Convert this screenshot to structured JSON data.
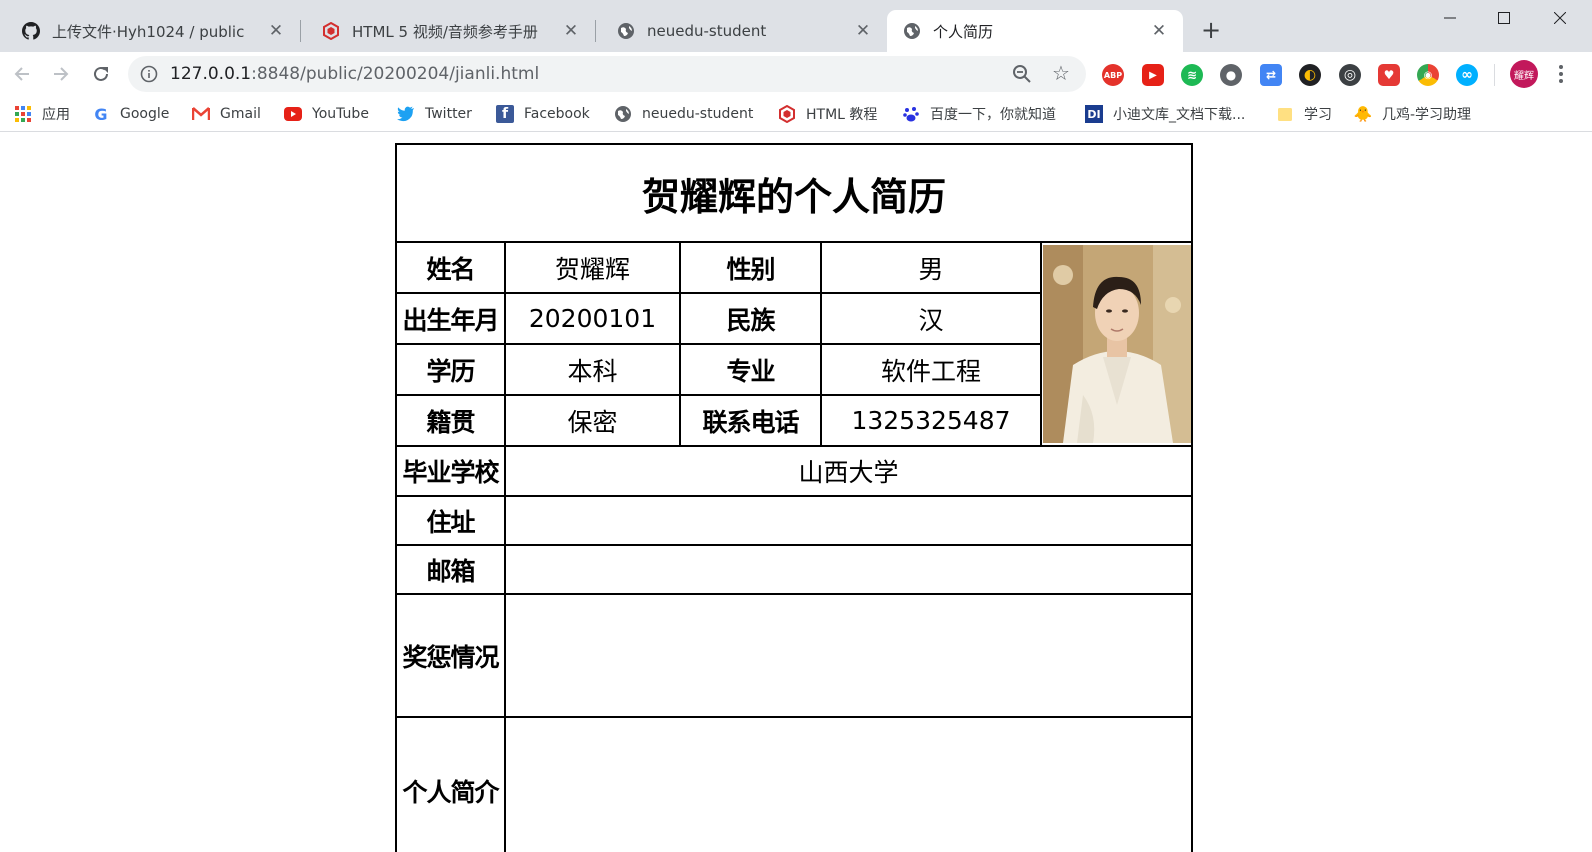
{
  "tabs": [
    {
      "title": "上传文件·Hyh1024 / public",
      "icon": "github-icon",
      "active": false
    },
    {
      "title": "HTML 5 视频/音频参考手册",
      "icon": "runoob-icon",
      "active": false
    },
    {
      "title": "neuedu-student",
      "icon": "globe-icon",
      "active": false
    },
    {
      "title": "个人简历",
      "icon": "globe-icon",
      "active": true
    }
  ],
  "toolbar": {
    "url_host": "127.0.0.1",
    "url_path": ":8848/public/20200204/jianli.html",
    "profile_label": "耀辉"
  },
  "extensions": [
    {
      "name": "adblock-plus-icon",
      "label": "ABP",
      "color": "#e4322b"
    },
    {
      "name": "youtube-ext-icon",
      "label": "▶",
      "color": "#e62117"
    },
    {
      "name": "spotify-ext-icon",
      "label": "≋",
      "color": "#1db954"
    },
    {
      "name": "people-ext-icon",
      "label": "●",
      "color": "#5f6368"
    },
    {
      "name": "translate-ext-icon",
      "label": "⇄",
      "color": "#4285f4"
    },
    {
      "name": "moon-ext-icon",
      "label": "◐",
      "color": "#202124"
    },
    {
      "name": "proxy-ext-icon",
      "label": "◎",
      "color": "#3c4043"
    },
    {
      "name": "red-ext-icon",
      "label": "♥",
      "color": "#e53935"
    },
    {
      "name": "chrome-ext-icon",
      "label": "◉",
      "color": "#fbbc04"
    },
    {
      "name": "infinity-ext-icon",
      "label": "∞",
      "color": "#00b0ff"
    }
  ],
  "bookmarks": [
    {
      "label": "应用",
      "icon": "apps-icon"
    },
    {
      "label": "Google",
      "icon": "google-icon"
    },
    {
      "label": "Gmail",
      "icon": "gmail-icon"
    },
    {
      "label": "YouTube",
      "icon": "youtube-icon"
    },
    {
      "label": "Twitter",
      "icon": "twitter-icon"
    },
    {
      "label": "Facebook",
      "icon": "facebook-icon"
    },
    {
      "label": "neuedu-student",
      "icon": "globe-icon"
    },
    {
      "label": "HTML 教程",
      "icon": "runoob-icon"
    },
    {
      "label": "百度一下，你就知道",
      "icon": "baidu-icon"
    },
    {
      "label": "小迪文库_文档下载...",
      "icon": "doc-icon"
    },
    {
      "label": "学习",
      "icon": "folder-icon"
    },
    {
      "label": "几鸡-学习助理",
      "icon": "chick-icon"
    }
  ],
  "resume": {
    "title": "贺耀辉的个人简历",
    "name_label": "姓名",
    "name": "贺耀辉",
    "gender_label": "性别",
    "gender": "男",
    "birth_label": "出生年月",
    "birth": "20200101",
    "ethnicity_label": "民族",
    "ethnicity": "汉",
    "education_label": "学历",
    "education": "本科",
    "major_label": "专业",
    "major": "软件工程",
    "hometown_label": "籍贯",
    "hometown": "保密",
    "phone_label": "联系电话",
    "phone": "1325325487",
    "school_label": "毕业学校",
    "school": "山西大学",
    "address_label": "住址",
    "address": "",
    "email_label": "邮箱",
    "email": "",
    "awards_label": "奖惩情况",
    "awards": "",
    "intro_label": "个人简介",
    "intro": ""
  }
}
